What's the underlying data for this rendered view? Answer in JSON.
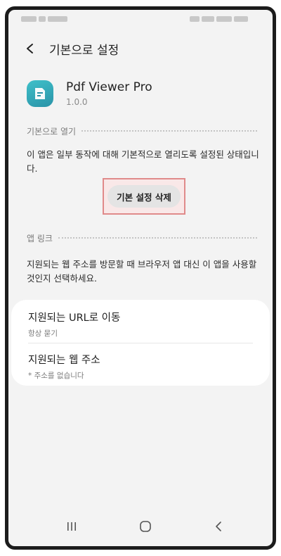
{
  "header": {
    "title": "기본으로 설정"
  },
  "app": {
    "name": "Pdf Viewer Pro",
    "version": "1.0.0"
  },
  "open_by_default": {
    "section_label": "기본으로 열기",
    "description": "이 앱은 일부 동작에 대해 기본적으로 열리도록 설정된 상태입니다.",
    "clear_button": "기본 설정 삭제"
  },
  "app_links": {
    "section_label": "앱 링크",
    "description_line1": "지원되는 웹 주소를 방문할 때 브라우저 앱 대신 이 앱을 사용할",
    "description_line2": "것인지 선택하세요."
  },
  "settings": [
    {
      "title": "지원되는 URL로 이동",
      "subtitle": "항상 묻기"
    },
    {
      "title": "지원되는 웹 주소",
      "subtitle": "* 주소를 없습니다"
    }
  ],
  "icons": {
    "back": "back-arrow-icon",
    "app": "pdf-app-icon",
    "nav_recents": "recents-icon",
    "nav_home": "home-icon",
    "nav_back": "nav-back-icon"
  },
  "colors": {
    "highlight": "#e08a8a",
    "app_icon": "#34a9b8"
  }
}
